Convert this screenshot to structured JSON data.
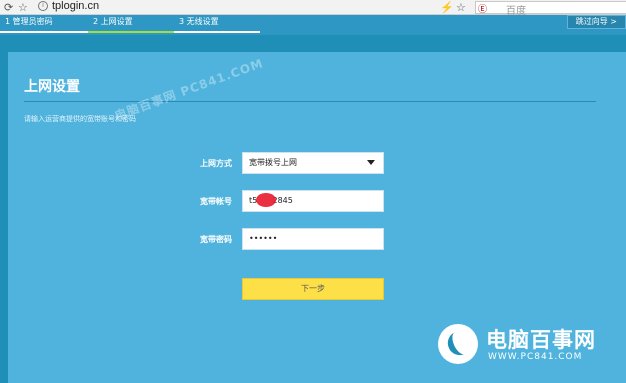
{
  "browser": {
    "url": "tplogin.cn",
    "search_placeholder": "百度",
    "search_engine": "Ⓔ"
  },
  "steps": [
    {
      "label": "1 管理员密码",
      "active": false
    },
    {
      "label": "2 上网设置",
      "active": true
    },
    {
      "label": "3 无线设置",
      "active": false
    }
  ],
  "skip_label": "跳过向导 >",
  "panel": {
    "title": "上网设置",
    "description": "请输入运营商提供的宽带账号和密码"
  },
  "form": {
    "mode_label": "上网方式",
    "mode_value": "宽带拨号上网",
    "account_label": "宽带帐号",
    "account_value": "t5      2845",
    "password_label": "宽带密码",
    "password_value": "••••••"
  },
  "next_label": "下一步",
  "watermark": {
    "diagonal": "电脑百事网  PC841.COM",
    "logo_text": "电脑百事网",
    "logo_url": "WWW.PC841.COM"
  }
}
